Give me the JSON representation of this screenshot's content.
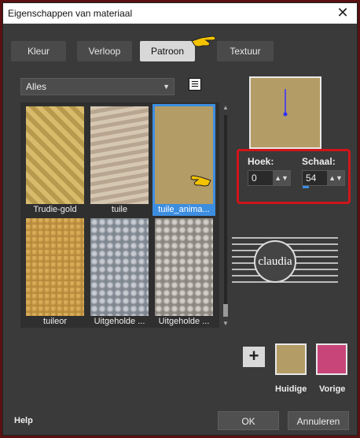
{
  "window": {
    "title": "Eigenschappen van materiaal",
    "close_glyph": "✕"
  },
  "tabs": [
    {
      "label": "Kleur",
      "active": false
    },
    {
      "label": "Verloop",
      "active": false
    },
    {
      "label": "Patroon",
      "active": true
    },
    {
      "label": "Textuur",
      "active": false
    }
  ],
  "category_select": {
    "value": "Alles"
  },
  "patterns": [
    {
      "label": "Trudie-gold",
      "selected": false,
      "color": "#c9a95a"
    },
    {
      "label": "tuile",
      "selected": false,
      "color": "#c8b8a4"
    },
    {
      "label": "tuile_anima...",
      "selected": true,
      "color": "#b49c66"
    },
    {
      "label": "tuileor",
      "selected": false,
      "color": "#c29a4c"
    },
    {
      "label": "Uitgeholde ...",
      "selected": false,
      "color": "#9aa0a8"
    },
    {
      "label": "Uitgeholde ...",
      "selected": false,
      "color": "#a8a4a0"
    }
  ],
  "angle": {
    "label": "Hoek:",
    "value": "0"
  },
  "scale": {
    "label": "Schaal:",
    "value": "54"
  },
  "logo": {
    "text": "claudia"
  },
  "swatches": {
    "current": {
      "label": "Huidige",
      "color": "#b49c66"
    },
    "previous": {
      "label": "Vorige",
      "color": "#c8457a"
    }
  },
  "buttons": {
    "help": "Help",
    "ok": "OK",
    "cancel": "Annuleren",
    "add": "+"
  },
  "colors": {
    "accent": "#3d8ee0",
    "highlight": "#d0151a"
  }
}
